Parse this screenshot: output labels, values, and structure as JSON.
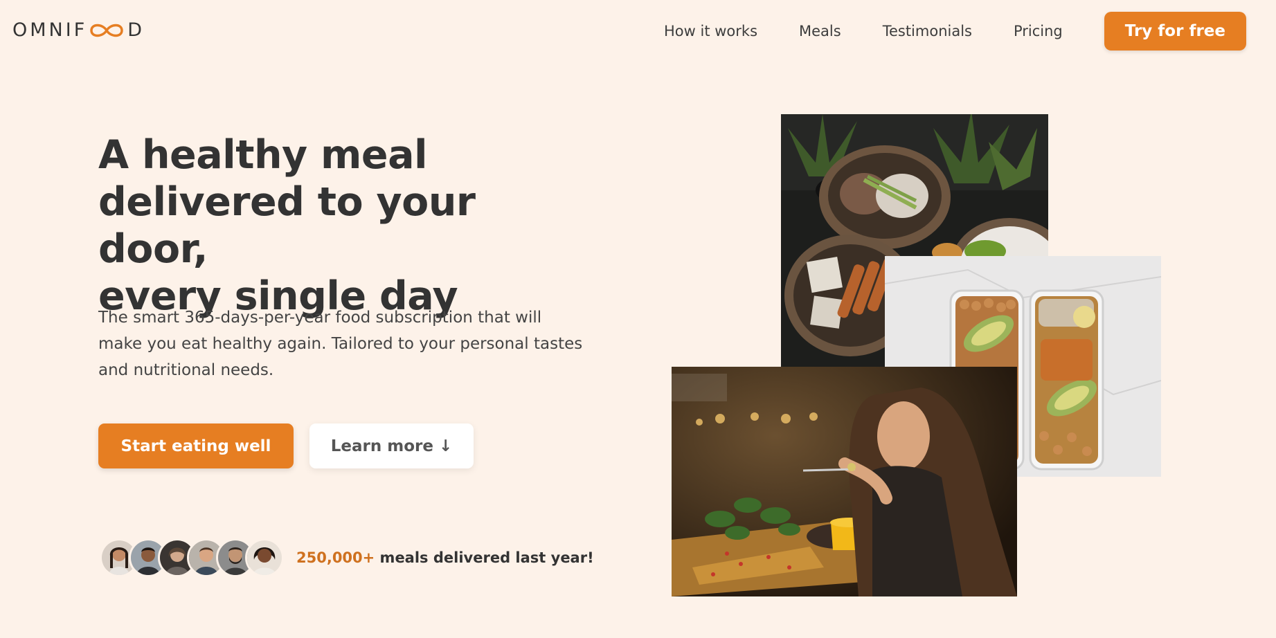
{
  "header": {
    "logo": {
      "part1": "OMNIF",
      "part2": "D",
      "icon": "infinity-icon"
    },
    "nav": [
      {
        "label": "How it works"
      },
      {
        "label": "Meals"
      },
      {
        "label": "Testimonials"
      },
      {
        "label": "Pricing"
      }
    ],
    "cta_label": "Try for free"
  },
  "hero": {
    "title_line1": "A healthy meal",
    "title_line2": "delivered to your door,",
    "title_line3": "every single day",
    "description": "The smart 365-days-per-year food subscription that will make you eat healthy again. Tailored to your personal tastes and nutritional needs.",
    "primary_button": "Start eating well",
    "secondary_button": "Learn more ↓",
    "delivered_count": "250,000+",
    "delivered_text": " meals delivered last year!"
  },
  "images": {
    "bowls": "meal-bowls-photo",
    "boxes": "meal-prep-boxes-photo",
    "woman": "woman-eating-photo"
  },
  "colors": {
    "background": "#fdf2e9",
    "accent": "#e67e22",
    "accent_dark": "#cf711f",
    "text": "#333333"
  }
}
